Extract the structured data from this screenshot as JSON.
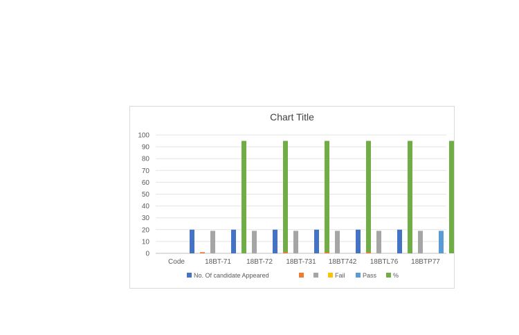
{
  "chart_data": {
    "type": "bar",
    "title": "Chart Title",
    "xlabel": "",
    "ylabel": "",
    "categories": [
      "Code",
      "18BT-71",
      "18BT-72",
      "18BT-731",
      "18BT742",
      "18BTL76",
      "18BTP77"
    ],
    "ylim": [
      0,
      100
    ],
    "yticks": [
      0,
      10,
      20,
      30,
      40,
      50,
      60,
      70,
      80,
      90,
      100
    ],
    "grid": true,
    "legend_position": "bottom",
    "series": [
      {
        "name": "No. Of candidate Appeared",
        "color": "#4472c4",
        "values": [
          0,
          20,
          20,
          20,
          20,
          20,
          20
        ]
      },
      {
        "name": "",
        "color": "#ed7d31",
        "values": [
          0,
          1,
          0,
          1,
          1,
          1,
          0
        ]
      },
      {
        "name": "",
        "color": "#a5a5a5",
        "values": [
          0,
          19,
          19,
          19,
          19,
          19,
          19
        ]
      },
      {
        "name": "Fail",
        "color": "#ffc000",
        "values": [
          0,
          0,
          0,
          0,
          0,
          0,
          0
        ]
      },
      {
        "name": "Pass",
        "color": "#5b9bd5",
        "values": [
          0,
          19,
          19,
          19,
          19,
          19,
          19
        ]
      },
      {
        "name": "%",
        "color": "#70ad47",
        "values": [
          0,
          95,
          95,
          95,
          95,
          95,
          95
        ]
      }
    ]
  }
}
